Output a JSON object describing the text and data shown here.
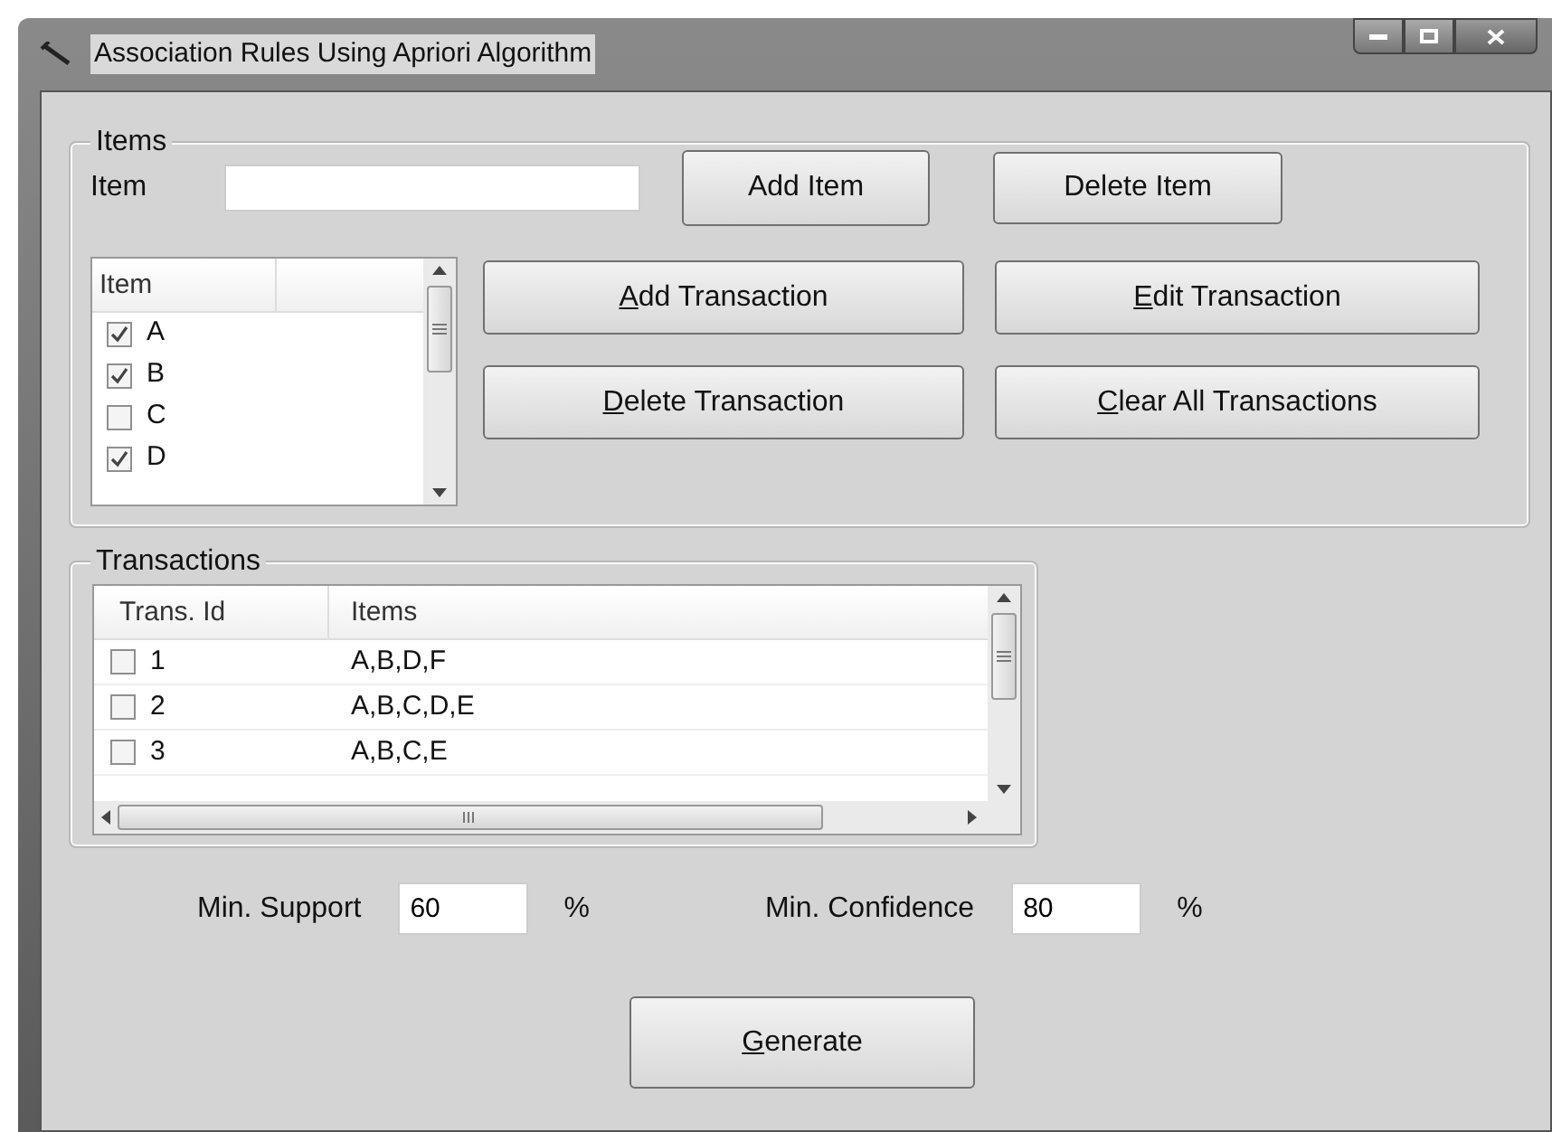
{
  "window": {
    "title": "Association Rules Using Apriori Algorithm"
  },
  "items_group": {
    "title": "Items",
    "item_label": "Item",
    "buttons": [
      {
        "label": "Add Item",
        "mnemonic": false
      },
      {
        "label": "Delete Item",
        "mnemonic": false
      }
    ],
    "item_list": {
      "columns": [
        "Item"
      ],
      "rows": [
        {
          "label": "A",
          "checked": true
        },
        {
          "label": "B",
          "checked": true
        },
        {
          "label": "C",
          "checked": false
        },
        {
          "label": "D",
          "checked": true
        }
      ]
    },
    "transaction_buttons": [
      {
        "label": "Add Transaction",
        "mnemonic": true
      },
      {
        "label": "Edit Transaction",
        "mnemonic": true
      },
      {
        "label": "Delete Transaction",
        "mnemonic": true
      },
      {
        "label": "Clear All Transactions",
        "mnemonic": true
      }
    ]
  },
  "transactions_group": {
    "title": "Transactions",
    "columns": [
      "Trans. Id",
      "Items"
    ],
    "rows": [
      {
        "id": "1",
        "items": "A,B,D,F",
        "checked": false
      },
      {
        "id": "2",
        "items": "A,B,C,D,E",
        "checked": false
      },
      {
        "id": "3",
        "items": "A,B,C,E",
        "checked": false
      }
    ]
  },
  "thresholds": [
    {
      "label": "Min. Support",
      "value": "60",
      "unit": "%"
    },
    {
      "label": "Min. Confidence",
      "value": "80",
      "unit": "%"
    }
  ],
  "generate_button": {
    "label": "Generate",
    "mnemonic": true
  }
}
